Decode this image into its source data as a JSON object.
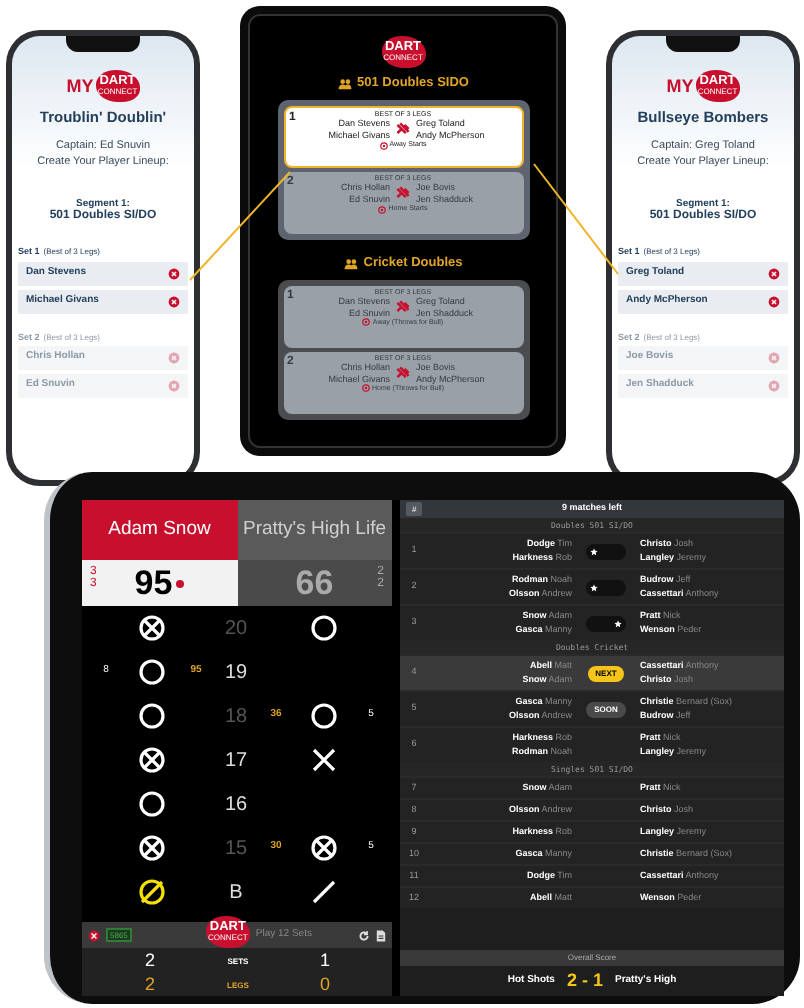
{
  "lineup_phones": [
    {
      "logo": {
        "prefix": "MY",
        "word": "DART",
        "sub": "CONNECT"
      },
      "team_name": "Troublin' Doublin'",
      "captain": "Captain: Ed Snuvin",
      "instruction": "Create Your Player Lineup:",
      "segment_label": "Segment 1:",
      "segment_name": "501 Doubles SI/DO",
      "sets": [
        {
          "label": "Set 1",
          "note": "(Best of 3 Legs)",
          "active": true,
          "players": [
            "Dan Stevens",
            "Michael Givans"
          ]
        },
        {
          "label": "Set 2",
          "note": "(Best of 3 Legs)",
          "active": false,
          "players": [
            "Chris Hollan",
            "Ed Snuvin"
          ]
        }
      ]
    },
    {
      "logo": {
        "prefix": "MY",
        "word": "DART",
        "sub": "CONNECT"
      },
      "team_name": "Bullseye Bombers",
      "captain": "Captain: Greg Toland",
      "instruction": "Create Your Player Lineup:",
      "segment_label": "Segment 1:",
      "segment_name": "501 Doubles SI/DO",
      "sets": [
        {
          "label": "Set 1",
          "note": "(Best of 3 Legs)",
          "active": true,
          "players": [
            "Greg Toland",
            "Andy McPherson"
          ]
        },
        {
          "label": "Set 2",
          "note": "(Best of 3 Legs)",
          "active": false,
          "players": [
            "Joe Bovis",
            "Jen Shadduck"
          ]
        }
      ]
    }
  ],
  "match_tablet": {
    "logo": {
      "word": "DART",
      "sub": "CONNECT"
    },
    "sections": [
      {
        "title": "501 Doubles SIDO",
        "games": [
          {
            "number": "1",
            "header": "BEST OF 3 LEGS",
            "home": [
              "Dan Stevens",
              "Michael Givans"
            ],
            "away": [
              "Greg Toland",
              "Andy McPherson"
            ],
            "note": "Away Starts",
            "selected": true
          },
          {
            "number": "2",
            "header": "BEST OF 3 LEGS",
            "home": [
              "Chris Hollan",
              "Ed Snuvin"
            ],
            "away": [
              "Joe Bovis",
              "Jen Shadduck"
            ],
            "note": "Home Starts",
            "selected": false
          }
        ]
      },
      {
        "title": "Cricket Doubles",
        "games": [
          {
            "number": "1",
            "header": "BEST OF 3 LEGS",
            "home": [
              "Dan Stevens",
              "Ed Snuvin"
            ],
            "away": [
              "Greg Toland",
              "Jen Shadduck"
            ],
            "note": "Away (Throws for Bull)",
            "selected": false
          },
          {
            "number": "2",
            "header": "BEST OF 3 LEGS",
            "home": [
              "Chris Hollan",
              "Michael Givans"
            ],
            "away": [
              "Joe Bovis",
              "Andy McPherson"
            ],
            "note": "Home (Throws for Bull)",
            "selected": false
          }
        ]
      }
    ]
  },
  "scoreboard": {
    "home": {
      "name": "Adam Snow",
      "marks": [
        "3",
        "3"
      ],
      "score": "95",
      "throwing": true
    },
    "away": {
      "name": "Pratty's High Life",
      "marks": [
        "2",
        "2"
      ],
      "score": "66",
      "throwing": false
    },
    "rows": [
      {
        "number": "20",
        "closed": true,
        "home": {
          "kind": "circle_x",
          "current": false
        },
        "away": {
          "kind": "circle",
          "current": false
        }
      },
      {
        "number": "19",
        "closed": false,
        "home": {
          "kind": "circle",
          "hits": "8",
          "points": "95",
          "current": false
        }
      },
      {
        "number": "18",
        "closed": true,
        "home": {
          "kind": "circle",
          "current": false
        },
        "away": {
          "kind": "circle",
          "hits": "5",
          "points": "36",
          "current": false
        }
      },
      {
        "number": "17",
        "closed": false,
        "home": {
          "kind": "circle_x",
          "current": false
        },
        "away": {
          "kind": "x",
          "current": false
        }
      },
      {
        "number": "16",
        "closed": false,
        "home": {
          "kind": "circle",
          "current": false
        }
      },
      {
        "number": "15",
        "closed": true,
        "home": {
          "kind": "circle_x",
          "current": false
        },
        "away": {
          "kind": "circle_x",
          "hits": "5",
          "points": "30",
          "current": false
        }
      },
      {
        "number": "B",
        "closed": false,
        "home": {
          "kind": "circle_slash",
          "current": true
        },
        "away": {
          "kind": "slash",
          "current": false
        }
      }
    ],
    "footer": {
      "code": "5865",
      "logo": {
        "word": "DART",
        "sub": "CONNECT"
      },
      "mode": "Play 12 Sets"
    },
    "totals": [
      {
        "label": "SETS",
        "home": "2",
        "away": "1",
        "highlight": false
      },
      {
        "label": "LEGS",
        "home": "2",
        "away": "0",
        "highlight": true
      }
    ]
  },
  "matches_panel": {
    "menu_label": "#",
    "title": "9 matches left",
    "groups": [
      {
        "title": "Doubles 501 SI/DO",
        "matches": [
          {
            "number": "1",
            "home": [
              {
                "last": "Dodge",
                "first": "Tim"
              },
              {
                "last": "Harkness",
                "first": "Rob"
              }
            ],
            "away": [
              {
                "last": "Christo",
                "first": "Josh"
              },
              {
                "last": "Langley",
                "first": "Jeremy"
              }
            ],
            "status": {
              "kind": "winner",
              "home_won": true
            },
            "selected": false
          },
          {
            "number": "2",
            "home": [
              {
                "last": "Rodman",
                "first": "Noah"
              },
              {
                "last": "Olsson",
                "first": "Andrew"
              }
            ],
            "away": [
              {
                "last": "Budrow",
                "first": "Jeff"
              },
              {
                "last": "Cassettari",
                "first": "Anthony"
              }
            ],
            "status": {
              "kind": "winner",
              "home_won": true
            },
            "selected": false
          },
          {
            "number": "3",
            "home": [
              {
                "last": "Snow",
                "first": "Adam"
              },
              {
                "last": "Gasca",
                "first": "Manny"
              }
            ],
            "away": [
              {
                "last": "Pratt",
                "first": "Nick"
              },
              {
                "last": "Wenson",
                "first": "Peder"
              }
            ],
            "status": {
              "kind": "winner",
              "home_won": false
            },
            "selected": false
          }
        ]
      },
      {
        "title": "Doubles Cricket",
        "matches": [
          {
            "number": "4",
            "home": [
              {
                "last": "Abell",
                "first": "Matt"
              },
              {
                "last": "Snow",
                "first": "Adam"
              }
            ],
            "away": [
              {
                "last": "Cassettari",
                "first": "Anthony"
              },
              {
                "last": "Christo",
                "first": "Josh"
              }
            ],
            "status": {
              "kind": "next",
              "text": "NEXT"
            },
            "selected": true
          },
          {
            "number": "5",
            "home": [
              {
                "last": "Gasca",
                "first": "Manny"
              },
              {
                "last": "Olsson",
                "first": "Andrew"
              }
            ],
            "away": [
              {
                "last": "Christie",
                "first": "Bernard (Sox)"
              },
              {
                "last": "Budrow",
                "first": "Jeff"
              }
            ],
            "status": {
              "kind": "soon",
              "text": "SOON"
            },
            "selected": false
          },
          {
            "number": "6",
            "home": [
              {
                "last": "Harkness",
                "first": "Rob"
              },
              {
                "last": "Rodman",
                "first": "Noah"
              }
            ],
            "away": [
              {
                "last": "Pratt",
                "first": "Nick"
              },
              {
                "last": "Langley",
                "first": "Jeremy"
              }
            ],
            "selected": false
          }
        ]
      },
      {
        "title": "Singles 501 SI/DO",
        "matches": [
          {
            "number": "7",
            "home": [
              {
                "last": "Snow",
                "first": "Adam"
              }
            ],
            "away": [
              {
                "last": "Pratt",
                "first": "Nick"
              }
            ],
            "selected": false
          },
          {
            "number": "8",
            "home": [
              {
                "last": "Olsson",
                "first": "Andrew"
              }
            ],
            "away": [
              {
                "last": "Christo",
                "first": "Josh"
              }
            ],
            "selected": false
          },
          {
            "number": "9",
            "home": [
              {
                "last": "Harkness",
                "first": "Rob"
              }
            ],
            "away": [
              {
                "last": "Langley",
                "first": "Jeremy"
              }
            ],
            "selected": false
          },
          {
            "number": "10",
            "home": [
              {
                "last": "Gasca",
                "first": "Manny"
              }
            ],
            "away": [
              {
                "last": "Christie",
                "first": "Bernard (Sox)"
              }
            ],
            "selected": false
          },
          {
            "number": "11",
            "home": [
              {
                "last": "Dodge",
                "first": "Tim"
              }
            ],
            "away": [
              {
                "last": "Cassettari",
                "first": "Anthony"
              }
            ],
            "selected": false
          },
          {
            "number": "12",
            "home": [
              {
                "last": "Abell",
                "first": "Matt"
              }
            ],
            "away": [
              {
                "last": "Wenson",
                "first": "Peder"
              }
            ],
            "selected": false
          }
        ]
      }
    ],
    "overall": {
      "label": "Overall Score",
      "home": "Hot Shots",
      "score": "2 - 1",
      "away": "Pratty's High"
    }
  }
}
